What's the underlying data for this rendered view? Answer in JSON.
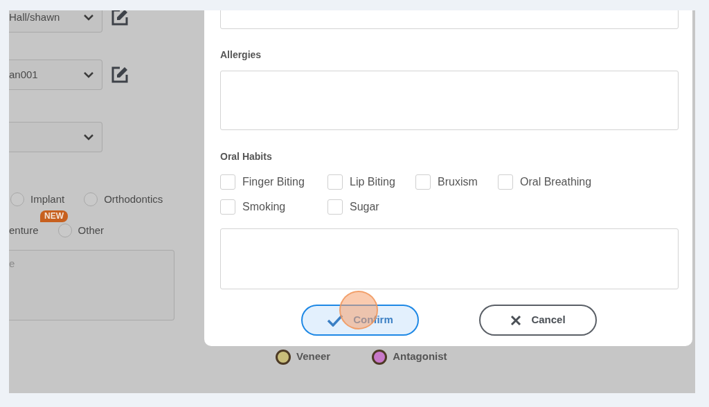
{
  "background_form": {
    "selects": [
      {
        "kind": "editable",
        "value": "Hall/shawn"
      },
      {
        "kind": "editable",
        "value": "an001"
      },
      {
        "kind": "plain"
      }
    ],
    "radio_rows": [
      [
        {
          "label": "Implant",
          "selected": false
        },
        {
          "label": "Orthodontics",
          "selected": false
        }
      ],
      [
        {
          "label": "enture",
          "badge": "NEW"
        },
        {
          "label": "Other",
          "selected": false
        }
      ]
    ],
    "notes": {
      "placeholder": "e"
    },
    "legend": [
      {
        "label": "Veneer",
        "color": "#c9bd7a"
      },
      {
        "label": "Antagonist",
        "color": "#c878c8"
      }
    ]
  },
  "dialog": {
    "allergies": {
      "label": "Allergies"
    },
    "oral_habits": {
      "label": "Oral Habits",
      "options": [
        {
          "label": "Finger Biting",
          "checked": false
        },
        {
          "label": "Lip Biting",
          "checked": false
        },
        {
          "label": "Bruxism",
          "checked": false
        },
        {
          "label": "Oral Breathing",
          "checked": false
        },
        {
          "label": "Smoking",
          "checked": false
        },
        {
          "label": "Sugar",
          "checked": false
        }
      ]
    },
    "buttons": [
      {
        "kind": "confirm",
        "label": "Confirm"
      },
      {
        "kind": "cancel",
        "label": "Cancel"
      }
    ]
  }
}
